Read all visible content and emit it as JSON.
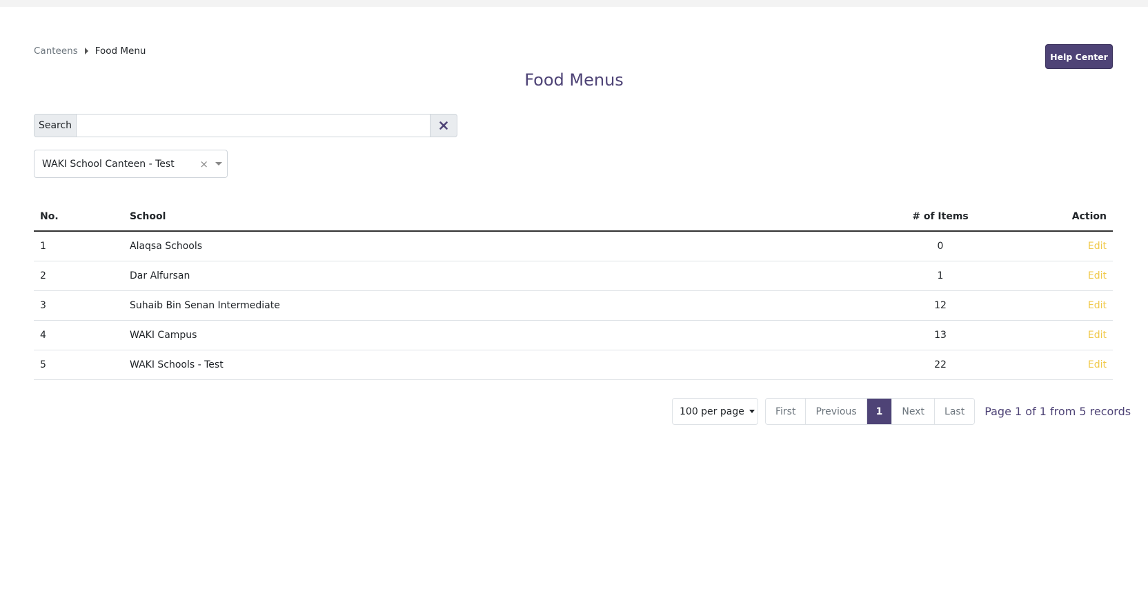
{
  "breadcrumb": {
    "parent": "Canteens",
    "current": "Food Menu"
  },
  "help_button": "Help Center",
  "page_title": "Food Menus",
  "search": {
    "label": "Search",
    "value": ""
  },
  "canteen_select": {
    "value": "WAKI School Canteen - Test",
    "clear": "×"
  },
  "table": {
    "headers": {
      "no": "No.",
      "school": "School",
      "items": "# of Items",
      "action": "Action"
    },
    "rows": [
      {
        "no": "1",
        "school": "Alaqsa Schools",
        "items": "0",
        "action": "Edit"
      },
      {
        "no": "2",
        "school": "Dar Alfursan",
        "items": "1",
        "action": "Edit"
      },
      {
        "no": "3",
        "school": "Suhaib Bin Senan Intermediate",
        "items": "12",
        "action": "Edit"
      },
      {
        "no": "4",
        "school": "WAKI Campus",
        "items": "13",
        "action": "Edit"
      },
      {
        "no": "5",
        "school": "WAKI Schools - Test",
        "items": "22",
        "action": "Edit"
      }
    ]
  },
  "pagination": {
    "per_page": "100 per page",
    "first": "First",
    "previous": "Previous",
    "current": "1",
    "next": "Next",
    "last": "Last",
    "info": "Page 1 of 1 from 5 records"
  },
  "colors": {
    "primary": "#4e4376",
    "edit": "#f0c94a"
  }
}
